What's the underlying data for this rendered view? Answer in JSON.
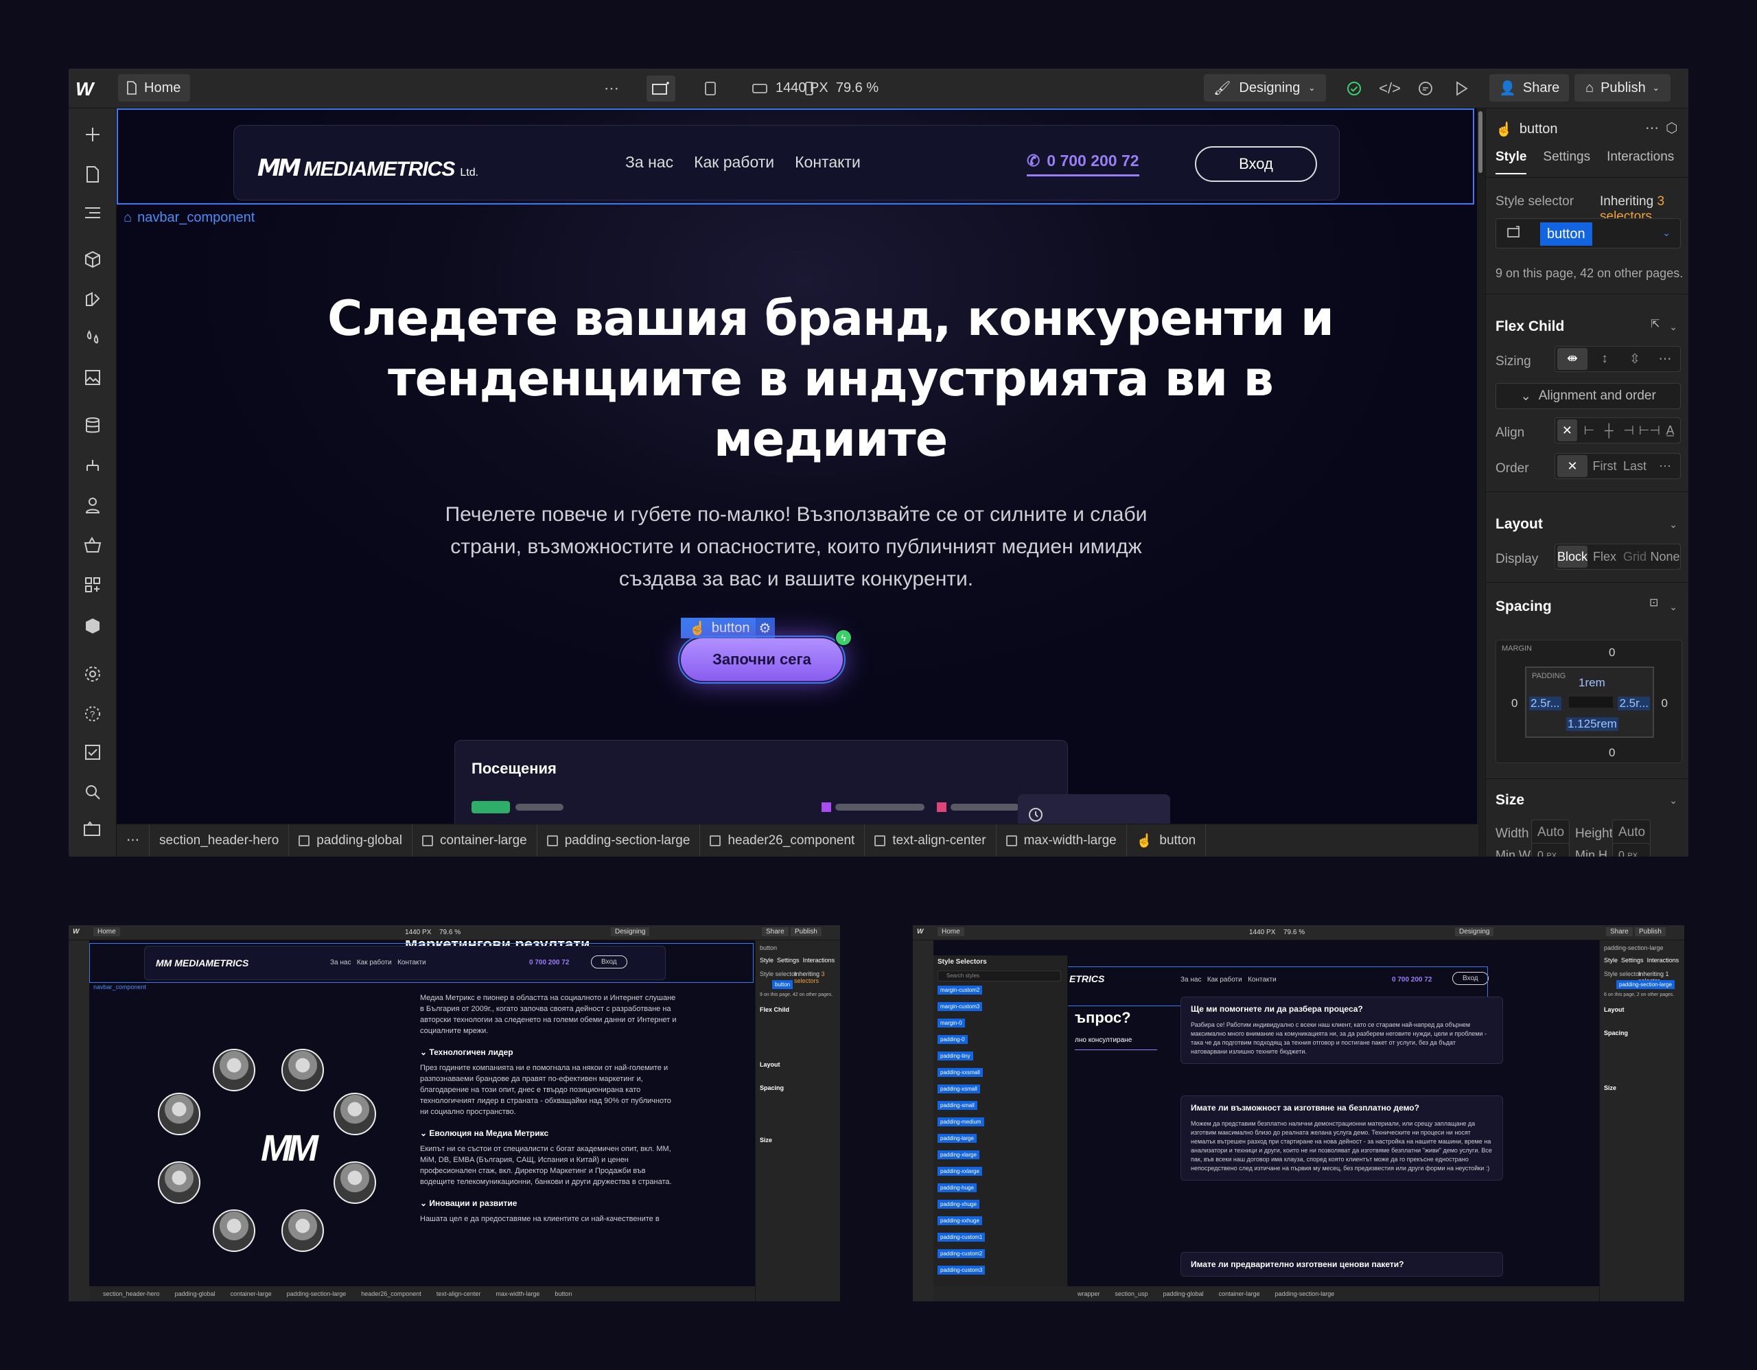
{
  "editor": {
    "page_name": "Home",
    "breakpoint_width": "1440 PX",
    "zoom": "79.6 %",
    "mode": "Designing",
    "share_label": "Share",
    "publish_label": "Publish"
  },
  "site": {
    "brand_mark": "MM",
    "brand_name": "MEDIAMETRICS",
    "brand_suffix": "Ltd.",
    "nav_links": [
      "За нас",
      "Как работи",
      "Контакти"
    ],
    "phone": "0 700 200 72",
    "login_label": "Вход",
    "selected_component": "navbar_component",
    "hero_title": "Следете вашия бранд, конкуренти и тенденциите в индустрията ви в медиите",
    "hero_subtitle": "Печелете повече и губете по-малко! Възползвайте се от силните и слаби страни, възможностите и опасностите, които публичният медиен имидж създава за вас и вашите конкуренти.",
    "selected_element_tag": "button",
    "cta_label": "Започни сега",
    "card_title": "Посещения"
  },
  "breadcrumb": [
    "section_header-hero",
    "padding-global",
    "container-large",
    "padding-section-large",
    "header26_component",
    "text-align-center",
    "max-width-large",
    "button"
  ],
  "panel": {
    "element": "button",
    "tabs": [
      "Style",
      "Settings",
      "Interactions"
    ],
    "style_selector_label": "Style selector",
    "inheriting_prefix": "Inheriting",
    "inheriting_count": "3 selectors",
    "selector_chip": "button",
    "usage_note": "9 on this page, 42 on other pages.",
    "flex_child_title": "Flex Child",
    "sizing_label": "Sizing",
    "alignment_toggle": "Alignment and order",
    "align_label": "Align",
    "order_label": "Order",
    "order_options": [
      "First",
      "Last"
    ],
    "layout_title": "Layout",
    "display_label": "Display",
    "display_options": [
      "Block",
      "Flex",
      "Grid",
      "None"
    ],
    "spacing_title": "Spacing",
    "margin_label": "MARGIN",
    "padding_label": "PADDING",
    "margin": {
      "top": "0",
      "right": "0",
      "bottom": "0",
      "left": "0"
    },
    "padding": {
      "top": "1rem",
      "right": "2.5r...",
      "bottom": "1.125rem",
      "left": "2.5r..."
    },
    "size_title": "Size",
    "width_label": "Width",
    "height_label": "Height",
    "width_value": "Auto",
    "height_value": "Auto",
    "minw_label": "Min W",
    "minh_label": "Min H",
    "minw_value": "0",
    "minh_value": "0",
    "unit": "PX"
  },
  "thumb1": {
    "heading": "Маркетингови резултати",
    "intro": "Медиа Метрикс е пионер в областта на социалното и Интернет слушане в България от 2009г., когато започва своята дейност с разработване на авторски технологии за следенето на големи обеми данни от Интернет и социалните мрежи.",
    "items": [
      {
        "title": "Технологичен лидер",
        "text": "През годините компанията ни е помогнала на някои от най-големите и разпознаваеми брандове да правят по-ефективен маркетинг и, благодарение на този опит, днес е твърдо позиционирана като технологичният лидер в страната - обхващайки над 90% от публичното ни социално пространство."
      },
      {
        "title": "Еволюция на Медиа Метрикс",
        "text": "Екипът ни се състои от специалисти с богат академичен опит, вкл. MM, MiM, DB, EMBA (България, САЩ, Испания и Китай) и ценен професионален стаж, вкл. Директор Маркетинг и Продажби във водещите телекомуникационни, банкови и други дружества в страната."
      },
      {
        "title": "Иновации и развитие",
        "text": "Нашата цел е да предоставяме на клиентите си най-качествените в"
      }
    ]
  },
  "thumb2": {
    "panel_title": "Style Selectors",
    "search_placeholder": "Search styles",
    "selectors": [
      "margin-custom2",
      "margin-custom3",
      "margin-0",
      "padding-0",
      "padding-tiny",
      "padding-xxsmall",
      "padding-xsmall",
      "padding-small",
      "padding-medium",
      "padding-large",
      "padding-xlarge",
      "padding-xxlarge",
      "padding-huge",
      "padding-xhuge",
      "padding-xxhuge",
      "padding-custom1",
      "padding-custom2",
      "padding-custom3"
    ],
    "left_heading": "ъпрос?",
    "left_sub": "лно консултиране",
    "selector_chip": "padding-section-large",
    "inheriting_count": "1 selector",
    "usage_note": "6 on this page, 2 on other pages.",
    "faqs": [
      {
        "q": "Ще ми помогнете ли да разбера процеса?",
        "a": "Разбира се! Работим индивидуално с всеки наш клиент, като се стараем най-напред да обърнем максимално много внимание на комуникацията ни, за да разберем неговите нужди, цели и проблеми - така че да подготвим подходящ за техния отговор и постигане пакет от услуги, без да бъдат натоварвани излишно техните бюджети."
      },
      {
        "q": "Имате ли възможност за изготвяне на безплатно демо?",
        "a": "Можем да представим безплатно налични демонстрационни материали, или срещу заплащане да изготвим максимално близо до реалната желана услуга демо. Техническите ни процеси ни носят немалък вътрешен разход при стартиране на нова дейност - за настройка на нашите машини, време на анализатори и техници и други, които не ни позволяват да изготвяме безплатни \"живи\" демо услуги. Все пак, във всеки наш договор има клауза, според която клиентът може да го прекъсне еднострано непосредствено след изтичане на първия му месец, без предизвестия или други форми на неустойки :)"
      },
      {
        "q": "Имате ли предварително изготвени ценови пакети?",
        "a": ""
      }
    ],
    "crumbs": [
      "wrapper",
      "section_usp",
      "padding-global",
      "container-large",
      "padding-section-large"
    ]
  }
}
